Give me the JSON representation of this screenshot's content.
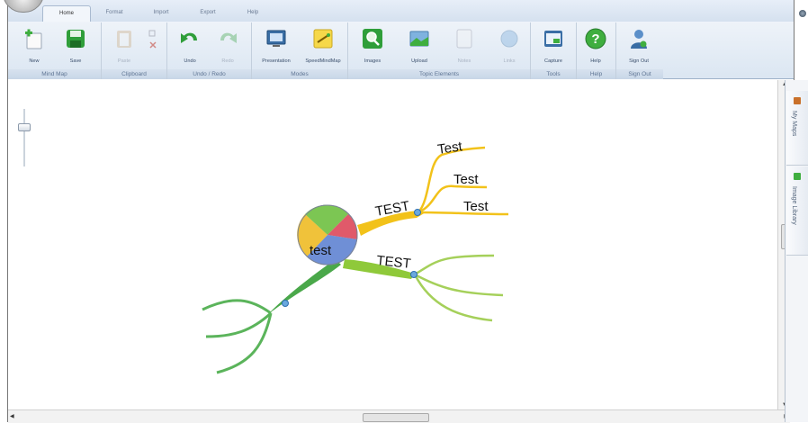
{
  "tabs": [
    {
      "label": "Home",
      "active": true
    },
    {
      "label": "Format",
      "active": false
    },
    {
      "label": "Import",
      "active": false
    },
    {
      "label": "Export",
      "active": false
    },
    {
      "label": "Help",
      "active": false
    }
  ],
  "ribbon": {
    "groups": {
      "mind_map": "Mind Map",
      "clipboard": "Clipboard",
      "undo_redo": "Undo / Redo",
      "modes": "Modes",
      "topic_elements": "Topic Elements",
      "tools": "Tools",
      "help": "Help",
      "sign_out": "Sign Out"
    },
    "buttons": {
      "new": "New",
      "save": "Save",
      "paste": "Paste",
      "undo": "Undo",
      "redo": "Redo",
      "presentation": "Presentation",
      "speedmindmap": "SpeedMindMap",
      "images": "Images",
      "upload": "Upload",
      "notes": "Notes",
      "links": "Links",
      "capture": "Capture",
      "help": "Help",
      "sign_out": "Sign Out"
    }
  },
  "sidebar": {
    "my_maps": "My Maps",
    "image_library": "Image Library"
  },
  "mindmap": {
    "central": "test",
    "branches": [
      {
        "label": "TEST",
        "color": "#f2c21a",
        "children": [
          "Test",
          "Test",
          "Test"
        ]
      },
      {
        "label": "TEST",
        "color": "#8fc93a",
        "children": [
          "",
          "",
          ""
        ]
      },
      {
        "label": "",
        "color": "#4aa84a",
        "children": [
          "",
          "",
          ""
        ]
      }
    ]
  },
  "colors": {
    "ribbon_bg": "#dbe6f2",
    "group_label": "#5f7594",
    "yellow_branch": "#f2c21a",
    "lightgreen_branch": "#8fc93a",
    "green_branch": "#4aa84a"
  }
}
